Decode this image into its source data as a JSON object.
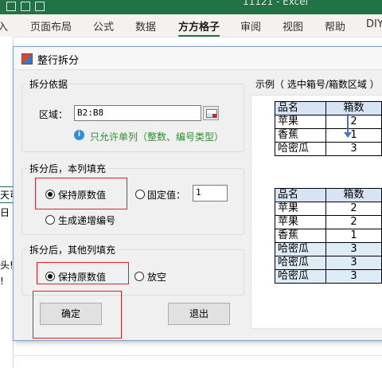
{
  "excel": {
    "window_title": "11121 - Excel",
    "tabs": [
      "入",
      "页面布局",
      "公式",
      "数据",
      "方方格子",
      "审阅",
      "视图",
      "帮助",
      "DIY"
    ],
    "active_tab_index": 4,
    "left_cells": [
      "天可",
      "日",
      "头!",
      "!"
    ]
  },
  "dialog": {
    "title": "整行拆分",
    "split_basis": {
      "group_label": "拆分依据",
      "range_label": "区域：",
      "range_value": "B2:B8",
      "hint": "只允许单列（整数、编号类型）"
    },
    "this_column": {
      "group_label": "拆分后，本列填充",
      "option_keep": "保持原数值",
      "option_fixed": "固定值：",
      "fixed_value": "1",
      "option_sequence": "生成递增编号",
      "selected": "keep"
    },
    "other_columns": {
      "group_label": "拆分后，其他列填充",
      "option_keep": "保持原数值",
      "option_empty": "放空",
      "selected": "keep"
    },
    "buttons": {
      "ok": "确定",
      "cancel": "退出"
    },
    "example": {
      "label": "示例（ 选中箱号/箱数区域 ）",
      "before": {
        "headers": [
          "品名",
          "箱数"
        ],
        "rows": [
          [
            "苹果",
            "2"
          ],
          [
            "香蕉",
            "1"
          ],
          [
            "哈密瓜",
            "3"
          ]
        ]
      },
      "after": {
        "headers": [
          "品名",
          "箱数"
        ],
        "rows": [
          [
            "苹果",
            "2"
          ],
          [
            "苹果",
            "2"
          ],
          [
            "香蕉",
            "1"
          ],
          [
            "哈密瓜",
            "3"
          ],
          [
            "哈密瓜",
            "3"
          ],
          [
            "哈密瓜",
            "3"
          ]
        ]
      }
    }
  }
}
